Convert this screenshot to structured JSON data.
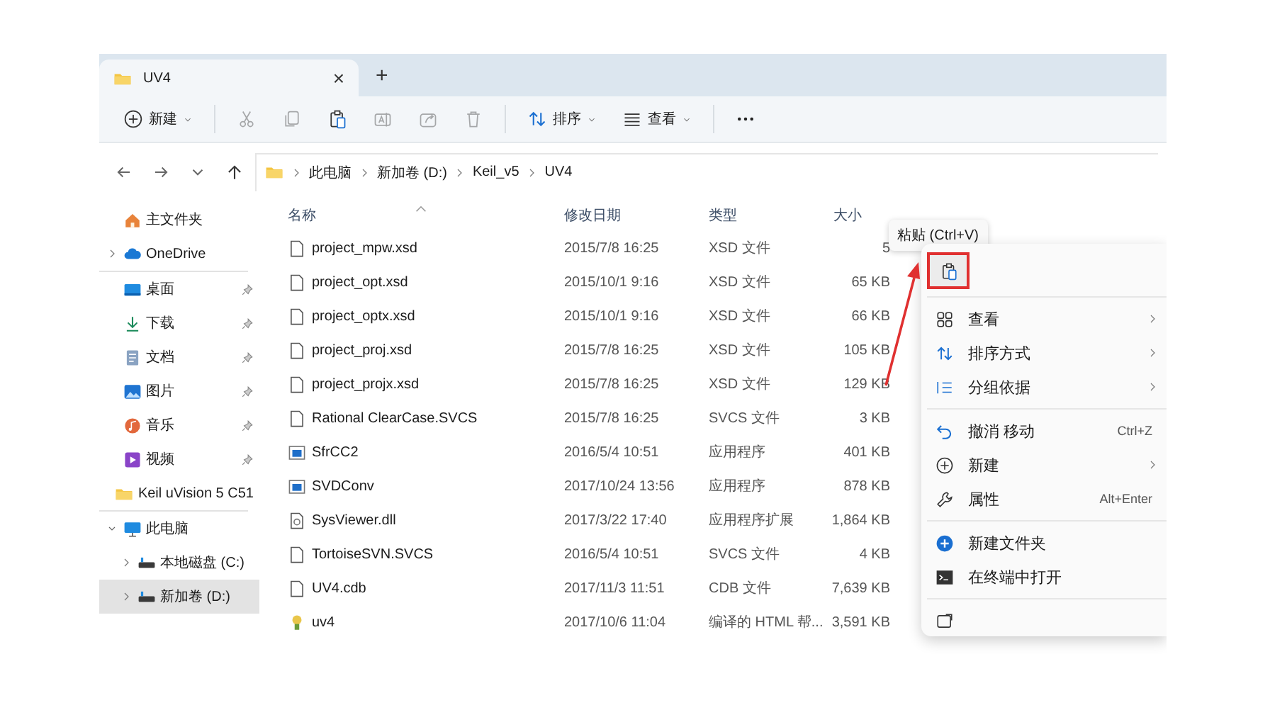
{
  "tabs": [
    {
      "title": "UV4",
      "selected": true,
      "close": "×"
    }
  ],
  "new_tab": "+",
  "toolbar": [
    {
      "kind": "new",
      "label": "新建",
      "dropdown": true,
      "disabled": false
    },
    {
      "kind": "cut",
      "disabled": true
    },
    {
      "kind": "copy",
      "disabled": true
    },
    {
      "kind": "paste",
      "disabled": false
    },
    {
      "kind": "rename",
      "disabled": true
    },
    {
      "kind": "share",
      "disabled": true
    },
    {
      "kind": "delete",
      "disabled": true
    },
    {
      "kind": "sort",
      "label": "排序",
      "dropdown": true,
      "disabled": false
    },
    {
      "kind": "view",
      "label": "查看",
      "dropdown": true,
      "disabled": false
    },
    {
      "kind": "more",
      "disabled": false
    }
  ],
  "breadcrumb": [
    "此电脑",
    "新加卷 (D:)",
    "Keil_v5",
    "UV4"
  ],
  "sidebar": {
    "groups": [
      [
        {
          "kind": "home",
          "label": "主文件夹",
          "selected": false
        },
        {
          "kind": "cloud",
          "label": "OneDrive",
          "expanded": false,
          "selected": false
        }
      ],
      [
        {
          "kind": "desktop",
          "label": "桌面",
          "pinned": true,
          "selected": false
        },
        {
          "kind": "download",
          "label": "下载",
          "pinned": true,
          "selected": false
        },
        {
          "kind": "document",
          "label": "文档",
          "pinned": true,
          "selected": false
        },
        {
          "kind": "picture",
          "label": "图片",
          "pinned": true,
          "selected": false
        },
        {
          "kind": "music",
          "label": "音乐",
          "pinned": true,
          "selected": false
        },
        {
          "kind": "video",
          "label": "视频",
          "pinned": true,
          "selected": false
        },
        {
          "kind": "folder",
          "label": "Keil uVision 5 C51",
          "pinned": false,
          "selected": false
        }
      ],
      [
        {
          "kind": "computer",
          "label": "此电脑",
          "expanded": true,
          "selected": false,
          "children": [
            {
              "kind": "drive",
              "label": "本地磁盘 (C:)",
              "expanded": false,
              "selected": false
            },
            {
              "kind": "drive",
              "label": "新加卷 (D:)",
              "expanded": false,
              "selected": true
            }
          ]
        }
      ]
    ]
  },
  "table": {
    "columns": [
      {
        "label": "名称",
        "sorted": true
      },
      {
        "label": "修改日期",
        "sorted": false
      },
      {
        "label": "类型",
        "sorted": false
      },
      {
        "label": "大小",
        "sorted": false
      }
    ],
    "rows": [
      {
        "kind": "file",
        "name": "project_mpw.xsd",
        "date": "2015/7/8 16:25",
        "type": "XSD 文件",
        "size": "5"
      },
      {
        "kind": "file",
        "name": "project_opt.xsd",
        "date": "2015/10/1 9:16",
        "type": "XSD 文件",
        "size": "65 KB"
      },
      {
        "kind": "file",
        "name": "project_optx.xsd",
        "date": "2015/10/1 9:16",
        "type": "XSD 文件",
        "size": "66 KB"
      },
      {
        "kind": "file",
        "name": "project_proj.xsd",
        "date": "2015/7/8 16:25",
        "type": "XSD 文件",
        "size": "105 KB"
      },
      {
        "kind": "file",
        "name": "project_projx.xsd",
        "date": "2015/7/8 16:25",
        "type": "XSD 文件",
        "size": "129 KB"
      },
      {
        "kind": "file",
        "name": "Rational ClearCase.SVCS",
        "date": "2015/7/8 16:25",
        "type": "SVCS 文件",
        "size": "3 KB"
      },
      {
        "kind": "app",
        "name": "SfrCC2",
        "date": "2016/5/4 10:51",
        "type": "应用程序",
        "size": "401 KB"
      },
      {
        "kind": "app",
        "name": "SVDConv",
        "date": "2017/10/24 13:56",
        "type": "应用程序",
        "size": "878 KB"
      },
      {
        "kind": "dll",
        "name": "SysViewer.dll",
        "date": "2017/3/22 17:40",
        "type": "应用程序扩展",
        "size": "1,864 KB"
      },
      {
        "kind": "file",
        "name": "TortoiseSVN.SVCS",
        "date": "2016/5/4 10:51",
        "type": "SVCS 文件",
        "size": "4 KB"
      },
      {
        "kind": "file",
        "name": "UV4.cdb",
        "date": "2017/11/3 11:51",
        "type": "CDB 文件",
        "size": "7,639 KB"
      },
      {
        "kind": "help",
        "name": "uv4",
        "date": "2017/10/6 11:04",
        "type": "编译的 HTML 帮...",
        "size": "3,591 KB"
      }
    ]
  },
  "context_menu": {
    "paste": {
      "tooltip": "粘贴 (Ctrl+V)",
      "highlighted": true
    },
    "groups": [
      [
        {
          "kind": "grid",
          "label": "查看",
          "submenu": true
        },
        {
          "kind": "sort",
          "label": "排序方式",
          "submenu": true
        },
        {
          "kind": "group",
          "label": "分组依据",
          "submenu": true
        }
      ],
      [
        {
          "kind": "undo",
          "label": "撤消 移动",
          "shortcut": "Ctrl+Z",
          "submenu": false
        },
        {
          "kind": "new",
          "label": "新建",
          "submenu": true
        },
        {
          "kind": "wrench",
          "label": "属性",
          "shortcut": "Alt+Enter",
          "submenu": false
        }
      ],
      [
        {
          "kind": "newfolder",
          "label": "新建文件夹",
          "submenu": false
        },
        {
          "kind": "terminal",
          "label": "在终端中打开",
          "submenu": false
        }
      ],
      [
        {
          "kind": "more",
          "submenu": false
        }
      ]
    ]
  },
  "annotation": {
    "arrow": true
  }
}
